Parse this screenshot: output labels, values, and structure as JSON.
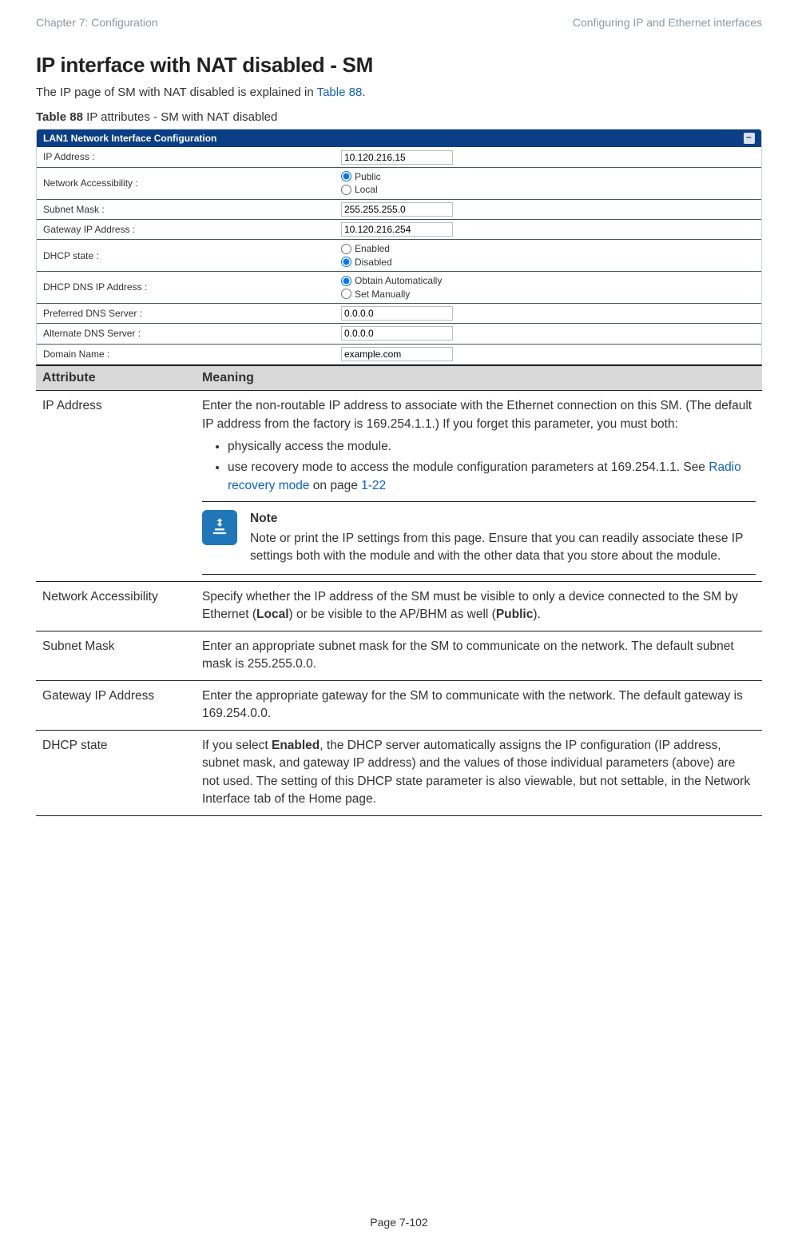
{
  "header": {
    "left": "Chapter 7:  Configuration",
    "right": "Configuring IP and Ethernet interfaces"
  },
  "title": "IP interface with NAT disabled - SM",
  "intro_prefix": "The IP page of SM with NAT disabled is explained in ",
  "intro_link": "Table 88",
  "intro_suffix": ".",
  "table_caption_strong": "Table 88",
  "table_caption_rest": " IP attributes - SM with NAT disabled",
  "form": {
    "panel_title": "LAN1 Network Interface Configuration",
    "rows": {
      "ip_address": {
        "label": "IP Address :",
        "value": "10.120.216.15"
      },
      "network_accessibility": {
        "label": "Network Accessibility :",
        "opt1": "Public",
        "opt2": "Local"
      },
      "subnet_mask": {
        "label": "Subnet Mask :",
        "value": "255.255.255.0"
      },
      "gateway": {
        "label": "Gateway IP Address :",
        "value": "10.120.216.254"
      },
      "dhcp_state": {
        "label": "DHCP state :",
        "opt1": "Enabled",
        "opt2": "Disabled"
      },
      "dhcp_dns": {
        "label": "DHCP DNS IP Address :",
        "opt1": "Obtain Automatically",
        "opt2": "Set Manually"
      },
      "pref_dns": {
        "label": "Preferred DNS Server :",
        "value": "0.0.0.0"
      },
      "alt_dns": {
        "label": "Alternate DNS Server :",
        "value": "0.0.0.0"
      },
      "domain": {
        "label": "Domain Name :",
        "value": "example.com"
      }
    }
  },
  "attr_table": {
    "head_attr": "Attribute",
    "head_meaning": "Meaning",
    "rows": [
      {
        "attr": "IP Address",
        "meaning_p1": "Enter the non-routable IP address to associate with the Ethernet connection on this SM. (The default IP address from the factory is 169.254.1.1.) If you forget this parameter, you must both:",
        "bullets": [
          "physically access the module.",
          "use recovery mode to access the module configuration parameters at 169.254.1.1. See "
        ],
        "bullet2_link": "Radio recovery mode",
        "bullet2_after": " on page ",
        "bullet2_pglink": "1-22",
        "note_title": "Note",
        "note_body": "Note or print the IP settings from this page. Ensure that you can readily associate these IP settings both with the module and with the other data that you store about the module."
      },
      {
        "attr": "Network Accessibility",
        "meaning": "Specify whether the IP address of the SM must be visible to only a device connected to the SM by Ethernet (",
        "bold1": "Local",
        "mid": ") or be visible to the AP/BHM as well (",
        "bold2": "Public",
        "end": ")."
      },
      {
        "attr": "Subnet Mask",
        "meaning": "Enter an appropriate subnet mask for the SM to communicate on the network. The default subnet mask is 255.255.0.0."
      },
      {
        "attr": "Gateway IP Address",
        "meaning": "Enter the appropriate gateway for the SM to communicate with the network. The default gateway is 169.254.0.0."
      },
      {
        "attr": "DHCP state",
        "meaning_pre": "If you select ",
        "bold": "Enabled",
        "meaning_post": ", the DHCP server automatically assigns the IP configuration (IP address, subnet mask, and gateway IP address) and the values of those individual parameters (above) are not used. The setting of this DHCP state parameter is also viewable, but not settable, in the Network Interface tab of the Home page."
      }
    ]
  },
  "page_number": "Page 7-102"
}
